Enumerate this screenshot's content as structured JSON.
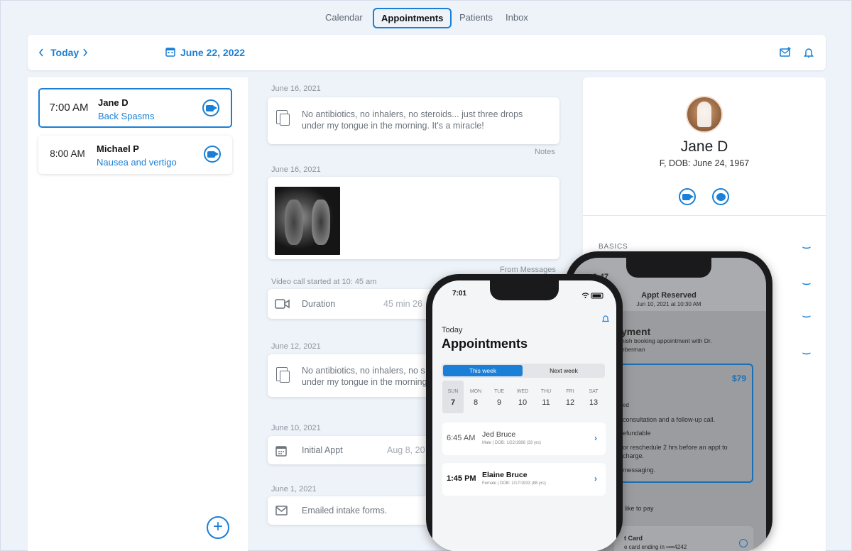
{
  "nav": {
    "tabs": [
      {
        "label": "Calendar",
        "active": false
      },
      {
        "label": "Appointments",
        "active": true
      },
      {
        "label": "Patients",
        "active": false
      },
      {
        "label": "Inbox",
        "active": false
      }
    ]
  },
  "header": {
    "today_label": "Today",
    "date_label": "June 22, 2022",
    "icons": [
      "chevron-left-icon",
      "chevron-right-icon",
      "calendar-icon",
      "mail-add-icon",
      "bell-icon"
    ]
  },
  "appointments": [
    {
      "time": "7:00 AM",
      "name": "Jane D",
      "reason": "Back Spasms",
      "selected": true
    },
    {
      "time": "8:00 AM",
      "name": "Michael P",
      "reason": "Nausea and vertigo",
      "selected": false
    }
  ],
  "feed": {
    "items": [
      {
        "date": "June 16, 2021",
        "text_line1": "No antibiotics, no inhalers, no steroids... just three drops",
        "text_line2": "under my tongue in the morning. It's a miracle!",
        "meta": "Notes"
      },
      {
        "date": "June 16, 2021",
        "meta": "From Messages"
      },
      {
        "date": "Video call started at 10: 45 am",
        "label": "Duration",
        "value": "45 min 26"
      },
      {
        "date": "June 12, 2021",
        "text_line1": "No antibiotics, no inhalers, no s",
        "text_line2": "under my tongue in the morning"
      },
      {
        "date": "June 10, 2021",
        "label": "Initial Appt",
        "value": "Aug 8, 20"
      },
      {
        "date": "June 1, 2021",
        "label": "Emailed intake forms."
      }
    ]
  },
  "patient": {
    "name": "Jane D",
    "dob": "F, DOB: June 24, 1967",
    "section": "BASICS"
  },
  "back_phone": {
    "time": "9:47",
    "title": "Appt Reserved",
    "subtitle": "Jun 10, 2021 at 10:30 AM",
    "heading": "yment",
    "desc1": "nish booking appointment with Dr.",
    "desc2": "eberman",
    "price": "$79",
    "line_ed": "ed",
    "line1": "consultation and a follow-up call.",
    "line2": "efundable",
    "line3": "or reschedule 2 hrs before an appt to",
    "line4": "charge.",
    "line5": "messaging.",
    "pay_label": "like to pay",
    "card_label": "t Card",
    "card_sub": "e card ending in ••••4242"
  },
  "front_phone": {
    "time": "7:01",
    "today": "Today",
    "title": "Appointments",
    "seg_on": "This week",
    "seg_off": "Next week",
    "days": [
      {
        "name": "SUN",
        "num": "7",
        "selected": true
      },
      {
        "name": "MON",
        "num": "8",
        "selected": false
      },
      {
        "name": "TUE",
        "num": "9",
        "selected": false
      },
      {
        "name": "WED",
        "num": "10",
        "selected": false
      },
      {
        "name": "THU",
        "num": "11",
        "selected": false
      },
      {
        "name": "FRI",
        "num": "12",
        "selected": false
      },
      {
        "name": "SAT",
        "num": "13",
        "selected": false
      }
    ],
    "patients": [
      {
        "time": "6:45 AM",
        "name": "Jed Bruce",
        "sub": "Male | DOB: 1/22/1988 (33 yrs)"
      },
      {
        "time": "1:45 PM",
        "name": "Elaine Bruce",
        "sub": "Female | DOB: 1/17/1933 (88 yrs)"
      }
    ]
  }
}
